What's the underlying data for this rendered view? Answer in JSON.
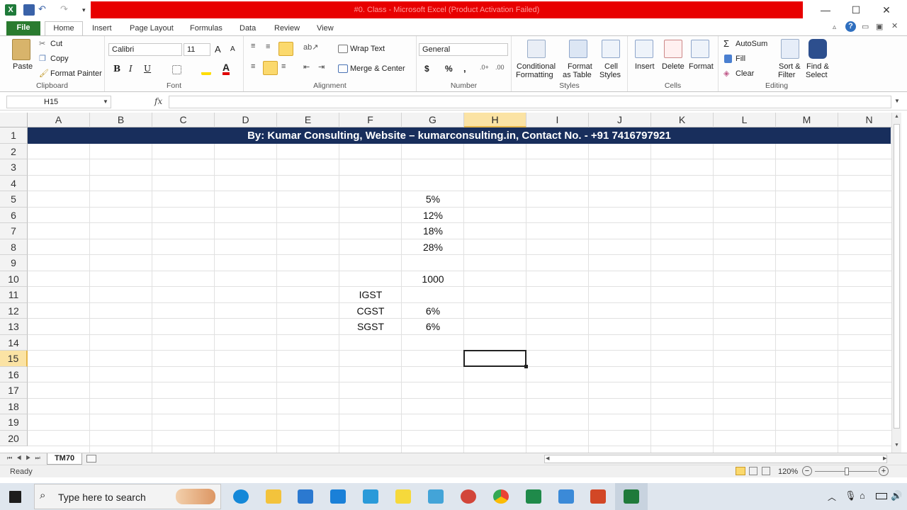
{
  "window": {
    "title": "#0. Class - Microsoft Excel (Product Activation Failed)",
    "minimize": "—",
    "maximize": "☐",
    "close": "✕"
  },
  "tabs": [
    "File",
    "Home",
    "Insert",
    "Page Layout",
    "Formulas",
    "Data",
    "Review",
    "View"
  ],
  "ribbon": {
    "clipboard": {
      "paste": "Paste",
      "cut": "Cut",
      "copy": "Copy",
      "format_painter": "Format Painter",
      "label": "Clipboard"
    },
    "font": {
      "name": "Calibri",
      "size": "11",
      "bold": "B",
      "italic": "I",
      "underline": "U",
      "label": "Font"
    },
    "alignment": {
      "wrap": "Wrap Text",
      "merge": "Merge & Center",
      "label": "Alignment"
    },
    "number": {
      "format": "General",
      "currency": "$",
      "percent": "%",
      "comma": ",",
      "label": "Number"
    },
    "styles": {
      "conditional": "Conditional",
      "conditional2": "Formatting",
      "format_table": "Format",
      "format_table2": "as Table",
      "cell_styles": "Cell",
      "cell_styles2": "Styles",
      "label": "Styles"
    },
    "cells": {
      "insert": "Insert",
      "delete": "Delete",
      "format": "Format",
      "label": "Cells"
    },
    "editing": {
      "autosum": "AutoSum",
      "fill": "Fill",
      "clear": "Clear",
      "sort": "Sort &",
      "sort2": "Filter",
      "find": "Find &",
      "find2": "Select",
      "label": "Editing"
    }
  },
  "formula_bar": {
    "name_box": "H15",
    "fx": "fx",
    "value": ""
  },
  "columns": [
    "A",
    "B",
    "C",
    "D",
    "E",
    "F",
    "G",
    "H",
    "I",
    "J",
    "K",
    "L",
    "M",
    "N"
  ],
  "rows": [
    "1",
    "2",
    "3",
    "4",
    "5",
    "6",
    "7",
    "8",
    "9",
    "10",
    "11",
    "12",
    "13",
    "14",
    "15",
    "16",
    "17",
    "18",
    "19",
    "20"
  ],
  "banner": "By: Kumar Consulting, Website – kumarconsulting.in, Contact No. - +91 7416797921",
  "cells": {
    "G5": "5%",
    "G6": "12%",
    "G7": "18%",
    "G8": "28%",
    "G10": "1000",
    "F11": "IGST",
    "F12": "CGST",
    "G12": "6%",
    "F13": "SGST",
    "G13": "6%"
  },
  "sheet_tab": "TM70",
  "status": {
    "ready": "Ready",
    "zoom": "120%"
  },
  "taskbar": {
    "search_placeholder": "Type here to search"
  }
}
